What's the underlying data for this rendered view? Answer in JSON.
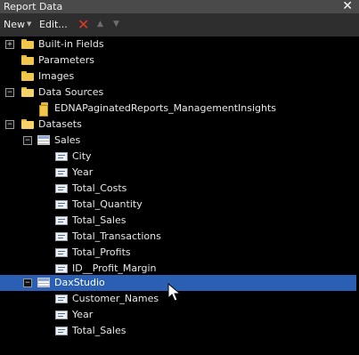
{
  "window": {
    "title": "Report Data"
  },
  "toolbar": {
    "new_label": "New",
    "edit_label": "Edit..."
  },
  "tree": {
    "built_in_fields": "Built-in Fields",
    "parameters": "Parameters",
    "images": "Images",
    "data_sources": "Data Sources",
    "data_source_item": "EDNAPaginatedReports_ManagementInsights",
    "datasets": "Datasets",
    "sales": {
      "name": "Sales",
      "fields": [
        "City",
        "Year",
        "Total_Costs",
        "Total_Quantity",
        "Total_Sales",
        "Total_Transactions",
        "Total_Profits",
        "ID__Profit_Margin"
      ]
    },
    "daxstudio": {
      "name": "DaxStudio",
      "fields": [
        "Customer_Names",
        "Year",
        "Total_Sales"
      ]
    }
  },
  "colors": {
    "selection": "#2a5fb3",
    "background": "#000000",
    "delete": "#e03c28"
  }
}
